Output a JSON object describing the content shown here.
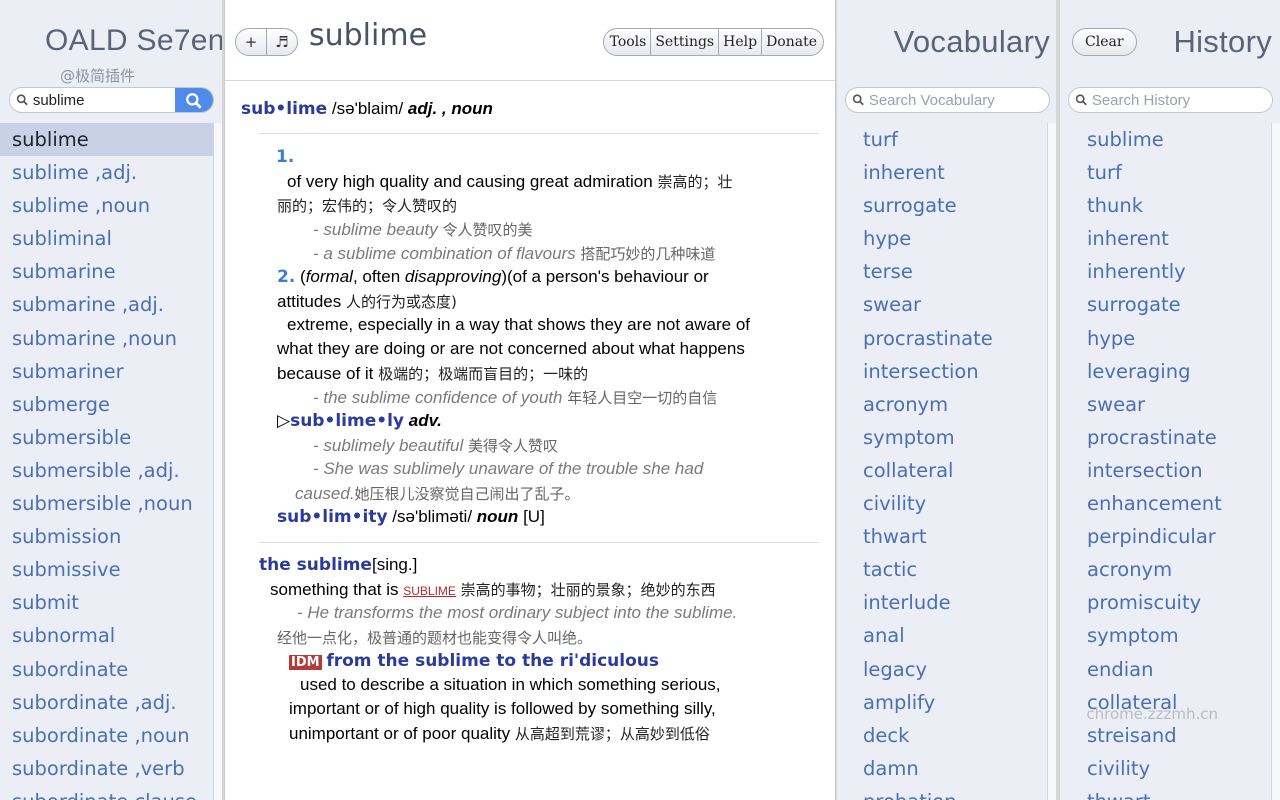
{
  "left": {
    "title": "OALD Se7en",
    "watermark": "@极简插件",
    "search_value": "sublime",
    "words": [
      "sublime",
      "sublime ,adj.",
      "sublime ,noun",
      "subliminal",
      "submarine",
      "submarine ,adj.",
      "submarine ,noun",
      "submariner",
      "submerge",
      "submersible",
      "submersible ,adj.",
      "submersible ,noun",
      "submission",
      "submissive",
      "submit",
      "subnormal",
      "subordinate",
      "subordinate ,adj.",
      "subordinate ,noun",
      "subordinate ,verb",
      "subordinate clause"
    ],
    "selected_index": 0
  },
  "center": {
    "add_label": "+",
    "audio_label": "♬",
    "headword": "sublime",
    "toolbar": [
      "Tools",
      "Settings",
      "Help",
      "Donate"
    ],
    "entry": {
      "hw": "sub•lime",
      "pron": "/sə'blaim/",
      "pos": "adj. , noun",
      "s1_num": "1.",
      "s1_def": "of very high quality and causing great admiration",
      "s1_zh1": "崇高的；壮",
      "s1_zh2": "丽的；宏伟的；令人赞叹的",
      "s1_ex1": "- sublime beauty",
      "s1_ex1_zh": "令人赞叹的美",
      "s1_ex2": "- a sublime combination of flavours",
      "s1_ex2_zh": "搭配巧妙的几种味道",
      "s2_num": "2.",
      "s2_lab_open": "(",
      "s2_lab_formal": "formal",
      "s2_lab_sep": ", often ",
      "s2_lab_disapproving": "disapproving",
      "s2_lab_close": ")(of a person's behaviour or",
      "s2_lab2": "attitudes",
      "s2_lab2_zh": "人的行为或态度)",
      "s2_def1": "extreme, especially in a way that shows they are not aware of",
      "s2_def2": "what they are doing or are not concerned about what happens",
      "s2_def3": "because of it",
      "s2_def3_zh": "极端的；极端而盲目的；一味的",
      "s2_ex1": "- the sublime confidence of youth",
      "s2_ex1_zh": "年轻人目空一切的自信",
      "deriv1_mark": "▷",
      "deriv1": "sub•lime•ly",
      "deriv1_pos": "adv.",
      "d1_ex1": "- sublimely beautiful",
      "d1_ex1_zh": "美得令人赞叹",
      "d1_ex2a": "- She was sublimely unaware of the trouble she had",
      "d1_ex2b": "caused.",
      "d1_ex2_zh": "她压根儿没察觉自己闹出了乱子。",
      "deriv2": "sub•lim•ity",
      "deriv2_pron": "/sə'blimǝti/",
      "deriv2_pos": "noun",
      "deriv2_tag": "[U]",
      "noun_hw": "the sublime",
      "noun_tag": "[sing.]",
      "noun_def": "something that is",
      "noun_xref": "sublime",
      "noun_zh": "崇高的事物；壮丽的景象；绝妙的东西",
      "noun_ex": "- He transforms the most ordinary subject into the sublime.",
      "noun_ex_zh": "经他一点化，极普通的题材也能变得令人叫绝。",
      "idm_tag": "IDM",
      "idm_phrase": "from the sublime to the ri'diculous",
      "idm_def1": "used to describe a situation in which something serious,",
      "idm_def2": "important or of high quality is followed by something silly,",
      "idm_def3": "unimportant or of poor quality",
      "idm_zh": "从高超到荒谬；从高妙到低俗"
    }
  },
  "vocab": {
    "title": "Vocabulary",
    "placeholder": "Search Vocabulary",
    "words": [
      "turf",
      "inherent",
      "surrogate",
      "hype",
      "terse",
      "swear",
      "procrastinate",
      "intersection",
      "acronym",
      "symptom",
      "collateral",
      "civility",
      "thwart",
      "tactic",
      "interlude",
      "anal",
      "legacy",
      "amplify",
      "deck",
      "damn",
      "probation"
    ]
  },
  "history": {
    "title": "History",
    "clear_label": "Clear",
    "placeholder": "Search History",
    "words": [
      "sublime",
      "turf",
      "thunk",
      "inherent",
      "inherently",
      "surrogate",
      "hype",
      "leveraging",
      "swear",
      "procrastinate",
      "intersection",
      "enhancement",
      "perpindicular",
      "acronym",
      "promiscuity",
      "symptom",
      "endian",
      "collateral",
      "streisand",
      "civility",
      "thwart"
    ],
    "site_mark": "chrome.zzzmh.cn"
  },
  "colors": {
    "accent": "#4f8be8",
    "link": "#4a6fb5",
    "headword": "#2b3b9c",
    "panel_bg": "#eceef5"
  },
  "icons": {
    "search": "search-icon",
    "add": "plus-icon",
    "audio": "audio-icon"
  }
}
